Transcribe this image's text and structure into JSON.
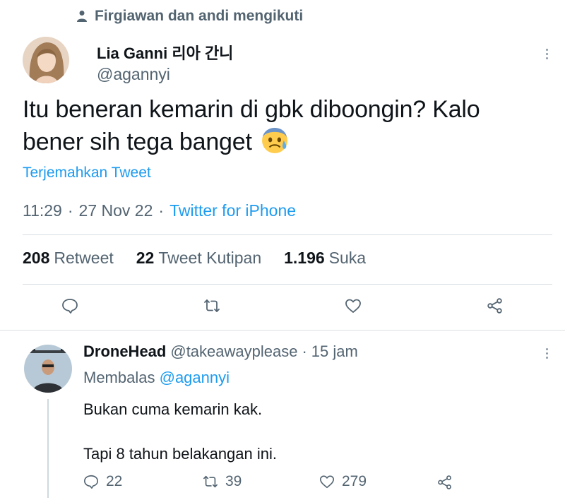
{
  "social_context": {
    "text": "Firgiawan dan andi mengikuti",
    "icon": "person-icon"
  },
  "tweet": {
    "author_name": "Lia Ganni 리아 간니",
    "author_handle": "@agannyi",
    "text_line1": "Itu beneran kemarin di gbk diboongin? Kalo",
    "text_line2": "bener sih tega banget",
    "emoji": "anxious-sweat-face-emoji",
    "translate_label": "Terjemahkan Tweet",
    "time": "11:29",
    "date": "27 Nov 22",
    "separator": "·",
    "source": "Twitter for iPhone",
    "stats": [
      {
        "value": "208",
        "label": "Retweet"
      },
      {
        "value": "22",
        "label": "Tweet Kutipan"
      },
      {
        "value": "1.196",
        "label": "Suka"
      }
    ],
    "actions": [
      "reply-icon",
      "retweet-icon",
      "like-icon",
      "share-icon"
    ]
  },
  "reply": {
    "author_name": "DroneHead",
    "author_handle": "@takeawayplease",
    "separator": "·",
    "time_ago": "15 jam",
    "replying_prefix": "Membalas",
    "replying_to": "@agannyi",
    "line1": "Bukan cuma kemarin kak.",
    "line2": "Tapi 8 tahun belakangan ini.",
    "reply_count": "22",
    "retweet_count": "39",
    "like_count": "279"
  },
  "colors": {
    "accent": "#1d9bf0",
    "text": "#0f1419",
    "muted": "#536471",
    "divider": "#d9dee2"
  }
}
